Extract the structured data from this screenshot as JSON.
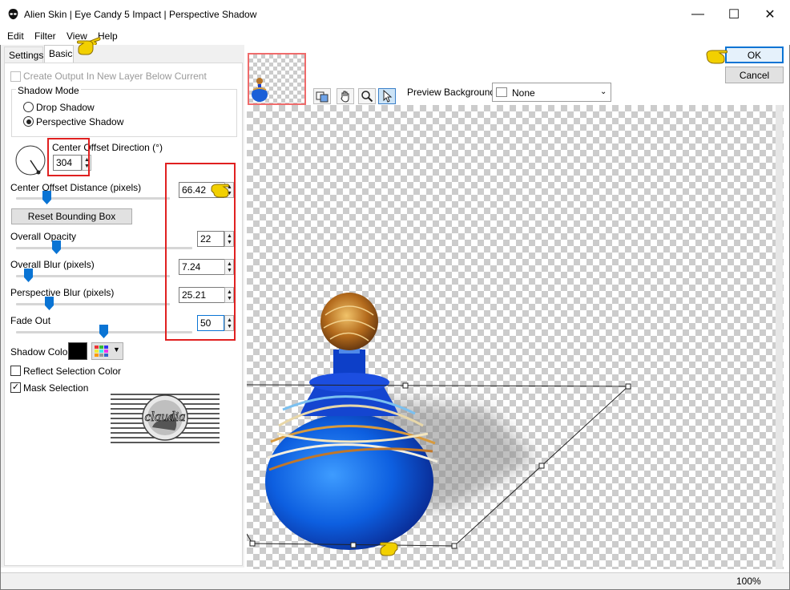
{
  "window": {
    "title": "Alien Skin | Eye Candy 5 Impact | Perspective Shadow",
    "minimize_glyph": "—",
    "maximize_glyph": "☐",
    "close_glyph": "✕"
  },
  "menu": [
    "Edit",
    "Filter",
    "View",
    "Help"
  ],
  "tabs": [
    "Settings",
    "Basic"
  ],
  "basic": {
    "create_output_label": "Create Output In New Layer Below Current",
    "create_output_checked": false,
    "shadow_mode_label": "Shadow Mode",
    "shadow_modes": [
      "Drop Shadow",
      "Perspective Shadow"
    ],
    "selected_mode": "Perspective Shadow",
    "direction": {
      "label": "Center Offset Direction (°)",
      "value": "304"
    },
    "distance": {
      "label": "Center Offset Distance (pixels)",
      "value": "66.42",
      "fraction": 0.12
    },
    "reset_button": "Reset Bounding Box",
    "opacity": {
      "label": "Overall Opacity",
      "value": "22",
      "fraction": 0.22
    },
    "blur": {
      "label": "Overall Blur (pixels)",
      "value": "7.24",
      "fraction": 0.07
    },
    "perspective_blur": {
      "label": "Perspective Blur (pixels)",
      "value": "25.21",
      "fraction": 0.2
    },
    "fade_out": {
      "label": "Fade Out",
      "value": "50",
      "fraction": 0.5
    },
    "shadow_color_label": "Shadow Color",
    "shadow_color": "#000000",
    "reflect_label": "Reflect Selection Color",
    "reflect_checked": false,
    "mask_label": "Mask Selection",
    "mask_checked": true,
    "logo_text": "claudia"
  },
  "buttons": {
    "ok": "OK",
    "cancel": "Cancel"
  },
  "preview": {
    "background_label": "Preview Background:",
    "background_value": "None",
    "tools": [
      "preview-toggle-icon",
      "hand-icon",
      "zoom-icon",
      "arrow-icon"
    ]
  },
  "status": {
    "zoom": "100%"
  },
  "colors": {
    "accent": "#0a74d4",
    "annotation_red": "#e02020",
    "hand_yellow": "#e8c000"
  }
}
